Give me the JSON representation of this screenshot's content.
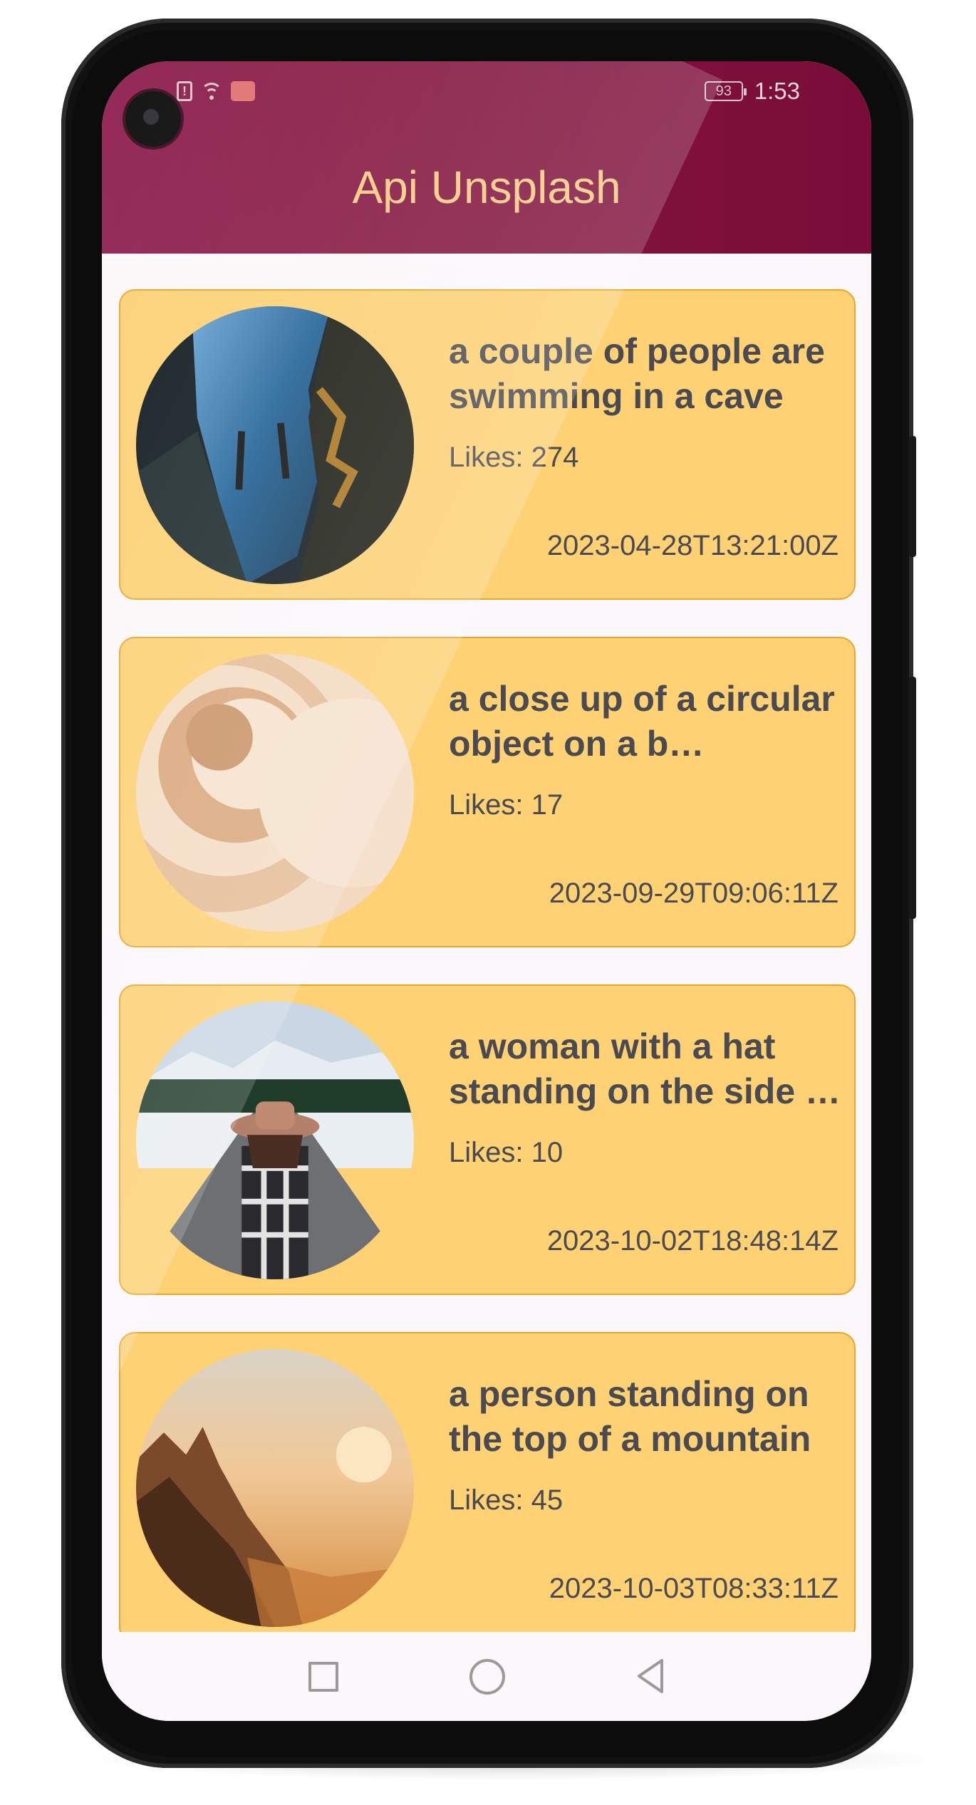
{
  "status_bar": {
    "alert_symbol": "!",
    "battery": "93",
    "time": "1:53"
  },
  "app_bar": {
    "title": "Api Unsplash"
  },
  "cards": [
    {
      "title": "a couple of people are swimming in a cave",
      "likes": "Likes: 274",
      "date": "2023-04-28T13:21:00Z",
      "image": "cave-divers-photo"
    },
    {
      "title": "a close up of a circular object on a b…",
      "likes": "Likes: 17",
      "date": "2023-09-29T09:06:11Z",
      "image": "abstract-circles-photo"
    },
    {
      "title": "a woman with a hat standing on the side …",
      "likes": "Likes: 10",
      "date": "2023-10-02T18:48:14Z",
      "image": "woman-on-road-photo"
    },
    {
      "title": "a person standing on the top of a mountain",
      "likes": "Likes: 45",
      "date": "2023-10-03T08:33:11Z",
      "image": "mountain-sunset-photo"
    }
  ],
  "nav_bar": {
    "icons": [
      "recents-square-icon",
      "home-circle-icon",
      "back-triangle-icon"
    ]
  },
  "colors": {
    "app_bar": "#84163f",
    "title": "#f7c983",
    "card_bg": "#fdd174",
    "card_border": "#e8a52d",
    "text": "#4a4a50"
  }
}
